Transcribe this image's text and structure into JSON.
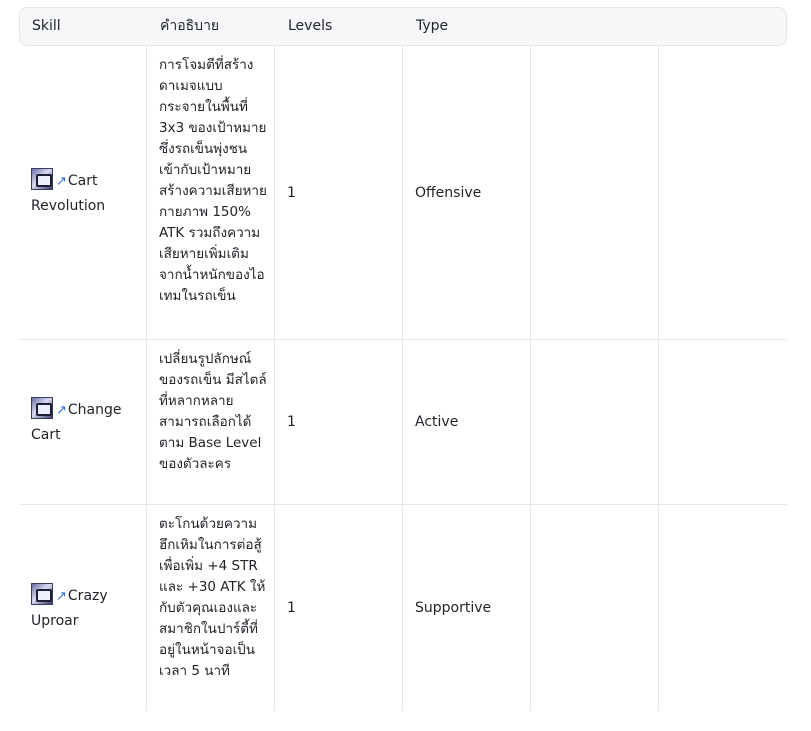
{
  "table": {
    "headers": [
      "Skill",
      "คำอธิบาย",
      "Levels",
      "Type"
    ],
    "rows": [
      {
        "skill_icon": "cart-revolution-icon",
        "skill_name": "Cart Revolution",
        "description": "การโจมตีที่สร้างดาเมจแบบกระจายในพื้นที่ 3x3 ของเป้าหมาย ซึ่งรถเข็นพุ่งชนเข้ากับเป้าหมาย สร้างความเสียหายกายภาพ 150% ATK รวมถึงความเสียหายเพิ่มเติมจากน้ำหนักของไอเทมในรถเข็น",
        "levels": "1",
        "type": "Offensive"
      },
      {
        "skill_icon": "change-cart-icon",
        "skill_name": "Change Cart",
        "description": "เปลี่ยนรูปลักษณ์ของรถเข็น มีสไตล์ที่หลากหลายสามารถเลือกได้ตาม Base Level ของตัวละคร",
        "levels": "1",
        "type": "Active"
      },
      {
        "skill_icon": "crazy-uproar-icon",
        "skill_name": "Crazy Uproar",
        "description": "ตะโกนด้วยความฮึกเหิมในการต่อสู้เพื่อเพิ่ม +4 STR และ +30 ATK ให้กับตัวคุณเองและสมาชิกในปาร์ตี้ที่อยู่ในหน้าจอเป็นเวลา 5 นาที",
        "levels": "1",
        "type": "Supportive"
      }
    ]
  }
}
